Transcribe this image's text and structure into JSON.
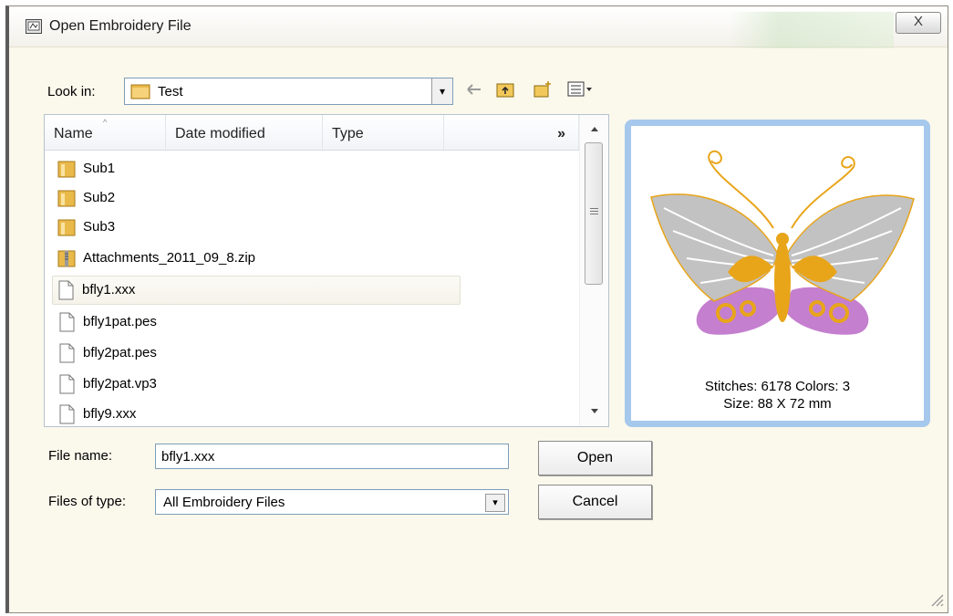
{
  "window": {
    "title": "Open Embroidery File",
    "close_glyph": "X"
  },
  "look_in": {
    "label": "Look in:",
    "value": "Test",
    "dropdown_glyph": "▾"
  },
  "toolbar": {
    "icons": [
      "back-arrow-icon",
      "up-folder-icon",
      "new-folder-icon",
      "view-menu-icon"
    ]
  },
  "file_list": {
    "columns": [
      "Name",
      "Date modified",
      "Type",
      "»"
    ],
    "items": [
      {
        "name": "Sub1",
        "kind": "folder"
      },
      {
        "name": "Sub2",
        "kind": "folder"
      },
      {
        "name": "Sub3",
        "kind": "folder"
      },
      {
        "name": "Attachments_2011_09_8.zip",
        "kind": "zip"
      },
      {
        "name": "bfly1.xxx",
        "kind": "file",
        "selected": true
      },
      {
        "name": "bfly1pat.pes",
        "kind": "file"
      },
      {
        "name": "bfly2pat.pes",
        "kind": "file"
      },
      {
        "name": "bfly2pat.vp3",
        "kind": "file"
      },
      {
        "name": "bfly9.xxx",
        "kind": "file"
      }
    ]
  },
  "preview": {
    "stitches_text": "Stitches:  6178  Colors:  3",
    "size_text": "Size:  88 X  72 mm",
    "colors": {
      "wing": "#c2c2c2",
      "body": "#e8a51a",
      "lower": "#c47fcf"
    }
  },
  "file_name": {
    "label": "File name:",
    "value": "bfly1.xxx"
  },
  "files_of_type": {
    "label": "Files of type:",
    "value": "All Embroidery Files"
  },
  "buttons": {
    "open": "Open",
    "cancel": "Cancel"
  }
}
